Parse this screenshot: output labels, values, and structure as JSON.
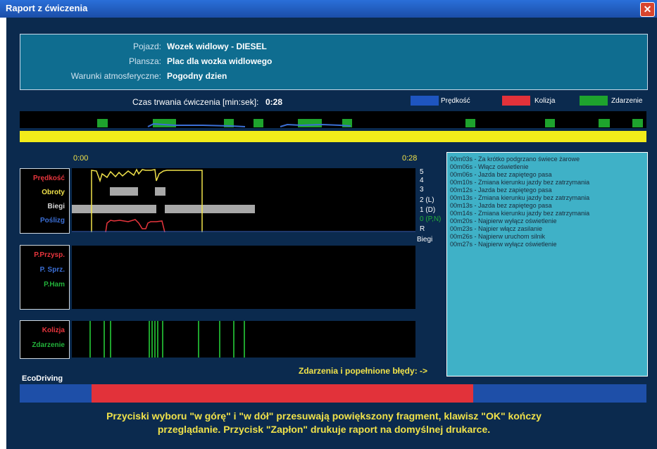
{
  "window": {
    "title": "Raport z ćwiczenia",
    "close_icon": "close-icon"
  },
  "info": {
    "vehicle_label": "Pojazd:",
    "vehicle_value": "Wozek widlowy - DIESEL",
    "board_label": "Plansza:",
    "board_value": "Plac dla wozka widlowego",
    "weather_label": "Warunki atmosferyczne:",
    "weather_value": "Pogodny dzien"
  },
  "duration": {
    "label": "Czas trwania ćwiczenia [min:sek]:",
    "value": "0:28"
  },
  "legend": [
    {
      "label": "Prędkość",
      "color": "#1e55c0"
    },
    {
      "label": "Kolizja",
      "color": "#e2323a"
    },
    {
      "label": "Zdarzenie",
      "color": "#1ea32d"
    }
  ],
  "time_axis": {
    "start": "0:00",
    "end": "0:28"
  },
  "channels": {
    "panel1": [
      {
        "label": "Prędkość",
        "color": "#e8353d"
      },
      {
        "label": "Obroty",
        "color": "#f0e24a"
      },
      {
        "label": "Biegi",
        "color": "#d8d8d8"
      },
      {
        "label": "Poślizg",
        "color": "#3b6fd6"
      }
    ],
    "panel2": [
      {
        "label": "P.Przysp.",
        "color": "#e8353d"
      },
      {
        "label": "P. Sprz.",
        "color": "#3b6fd6"
      },
      {
        "label": "P.Ham",
        "color": "#22b23a"
      }
    ],
    "panel3": [
      {
        "label": "Kolizja",
        "color": "#e8353d"
      },
      {
        "label": "Zdarzenie",
        "color": "#22b23a"
      }
    ]
  },
  "gears": {
    "levels": [
      "5",
      "4",
      "3",
      "2 (L)",
      "1 (D)",
      "0 (P,N)",
      "R"
    ],
    "axis_title": "Biegi",
    "neutral_color": "#22b23a"
  },
  "events": [
    "00m03s - Za krótko podgrzano świece żarowe",
    "00m06s - Włącz oświetlenie",
    "00m06s - Jazda bez zapiętego pasa",
    "00m10s - Zmiana kierunku jazdy bez zatrzymania",
    "00m12s - Jazda bez zapiętego pasa",
    "00m13s - Zmiana kierunku jazdy bez zatrzymania",
    "00m13s - Jazda bez zapiętego pasa",
    "00m14s - Zmiana kierunku jazdy bez zatrzymania",
    "00m20s - Najpierw wyłącz oświetlenie",
    "00m23s - Najpier włącz zasilanie",
    "00m26s - Najpierw uruchom silnik",
    "00m27s - Najpierw wyłącz oświetlenie"
  ],
  "errors_link": "Zdarzenia i popełnione błędy: ->",
  "ecodriving": {
    "title": "EcoDriving"
  },
  "footer": {
    "line1": "Przyciski wyboru \"w górę\" i \"w dół\" przesuwają powiększony fragment, klawisz \"OK\" kończy",
    "line2": "przeglądanie. Przycisk \"Zapłon\" drukuje raport na domyślnej drukarce."
  }
}
